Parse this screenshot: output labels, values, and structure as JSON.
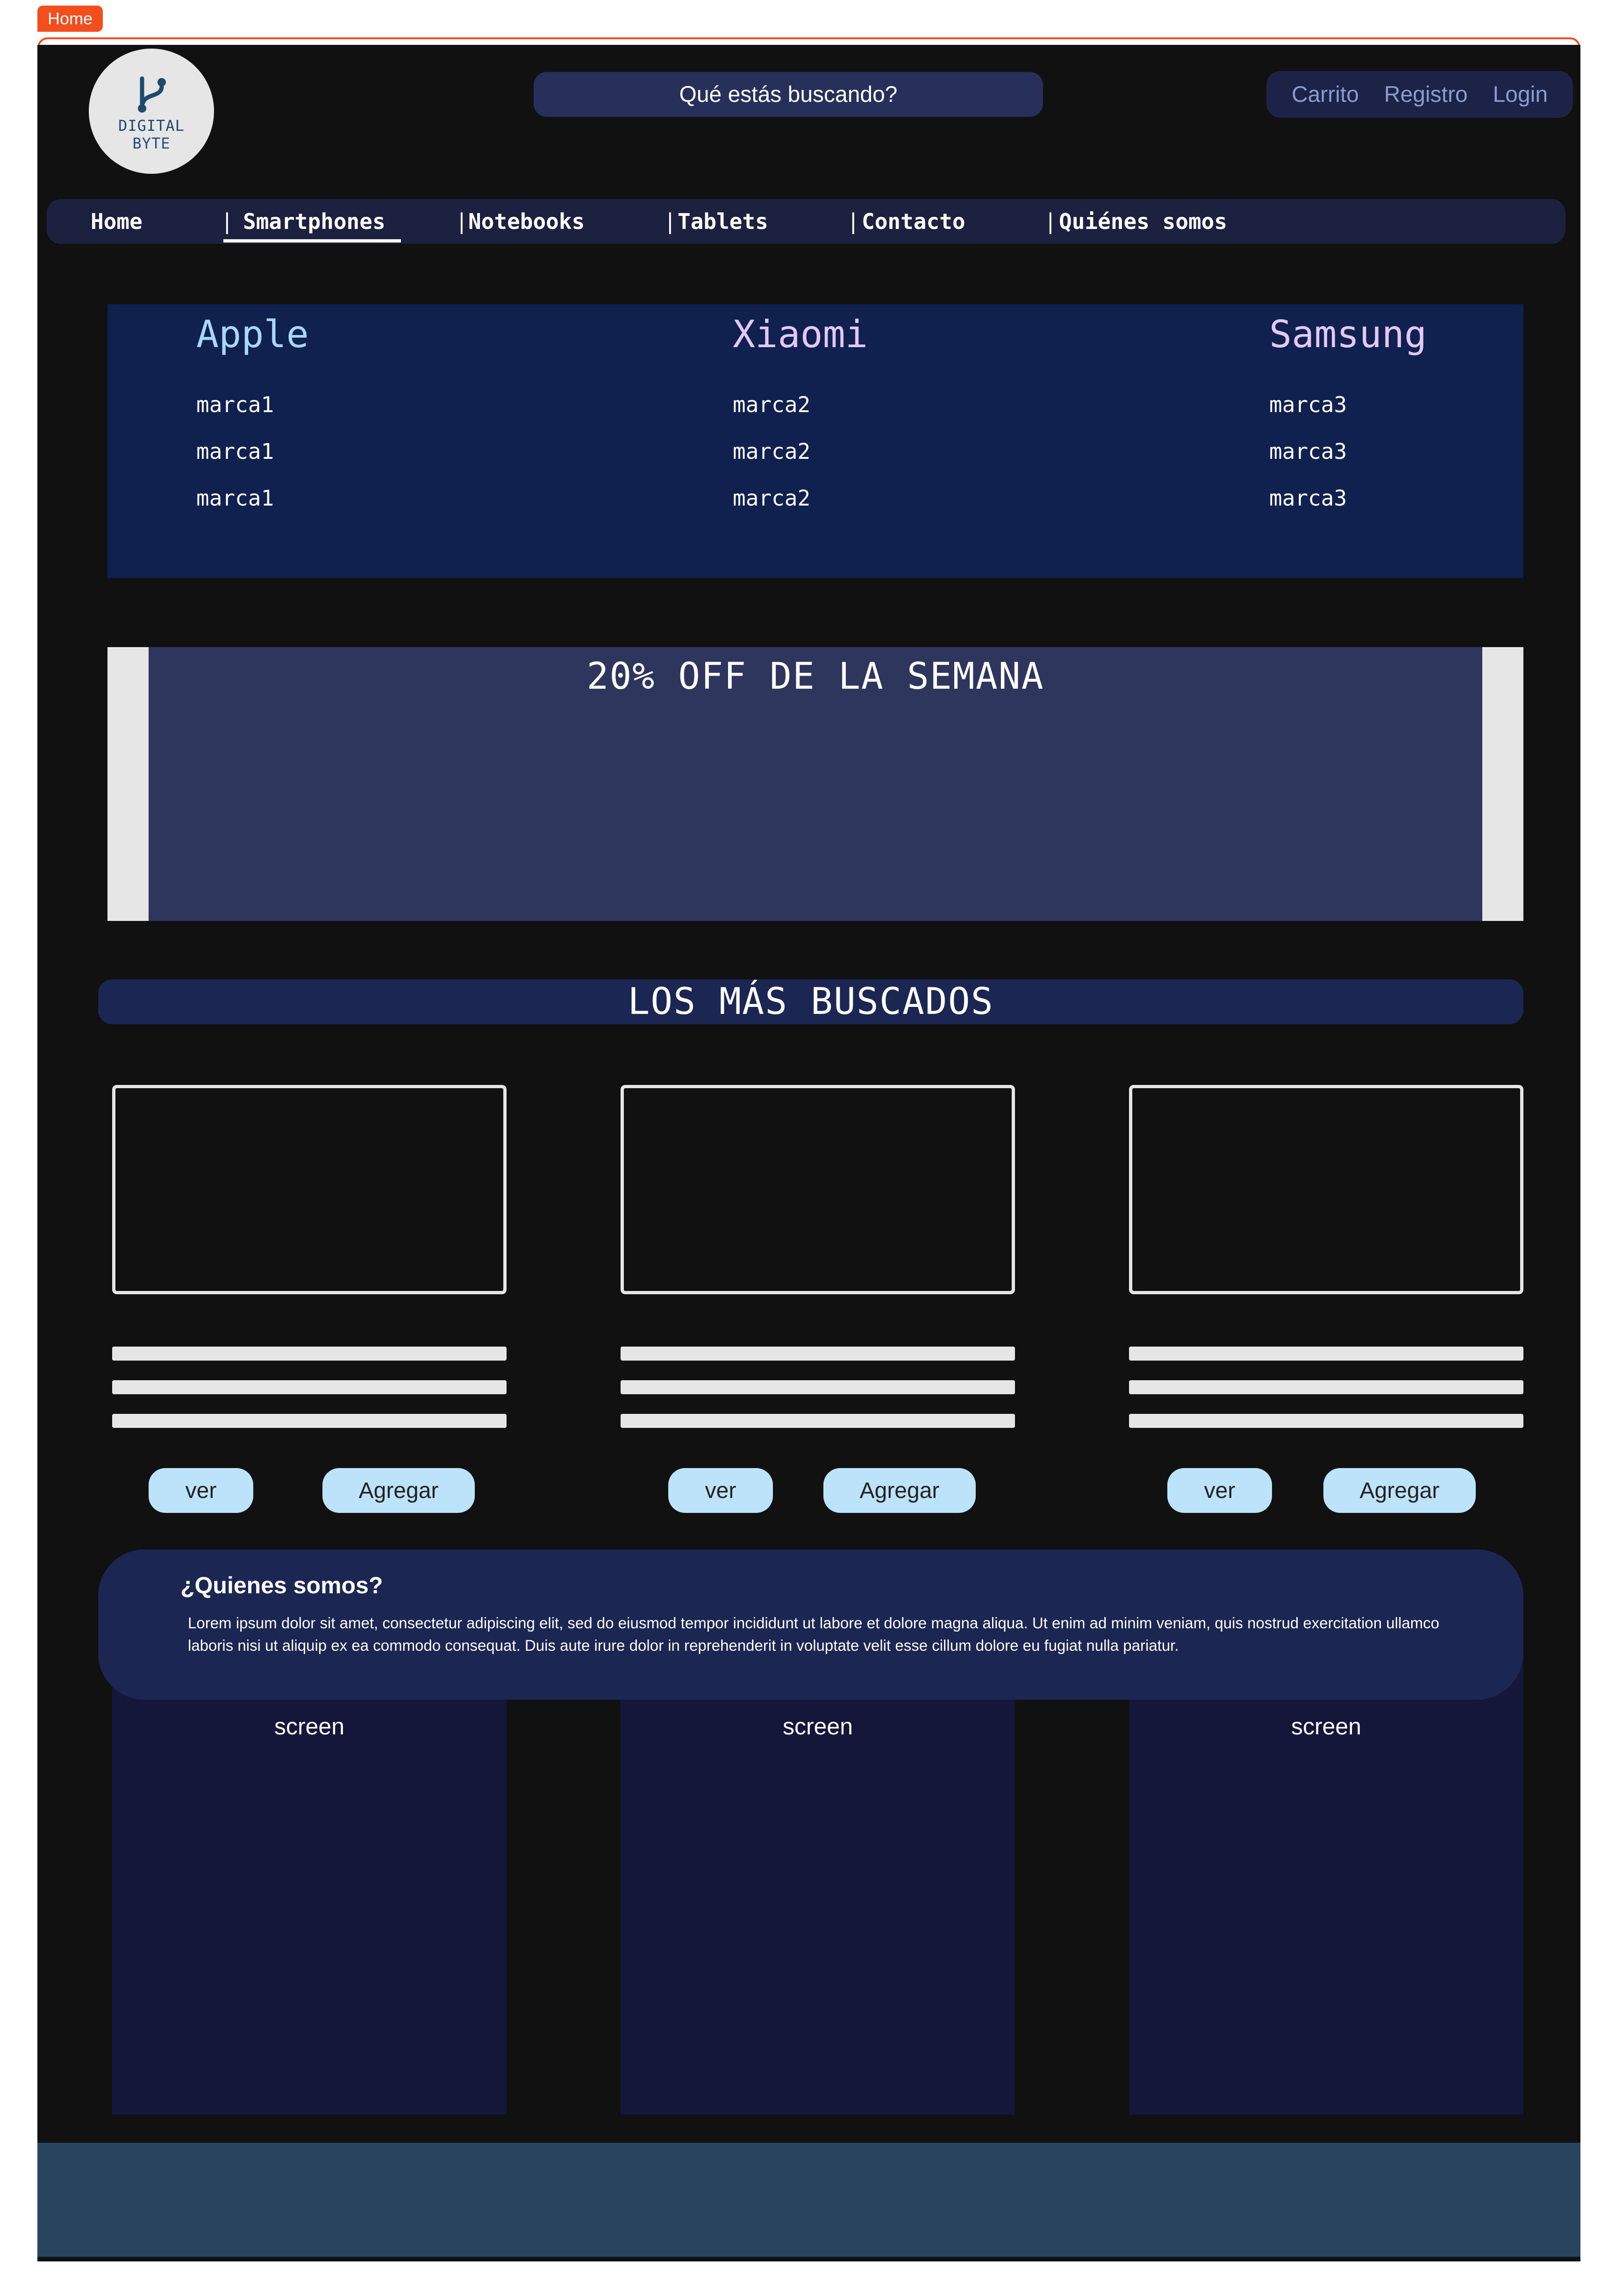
{
  "frame": {
    "label": "Home"
  },
  "logo": {
    "line1": "DIGITAL",
    "line2": "BYTE"
  },
  "search": {
    "placeholder": "Qué estás buscando?"
  },
  "user_nav": {
    "cart": "Carrito",
    "register": "Registro",
    "login": "Login"
  },
  "main_nav": {
    "items": [
      "Home",
      "Smartphones",
      "Notebooks",
      "Tablets",
      "Contacto",
      "Quiénes somos"
    ],
    "separator": "|",
    "active": "Smartphones"
  },
  "brands": [
    {
      "title": "Apple",
      "color": "#a8d8f8",
      "items": [
        "marca1",
        "marca1",
        "marca1"
      ]
    },
    {
      "title": "Xiaomi",
      "color": "#e3c8f5",
      "items": [
        "marca2",
        "marca2",
        "marca2"
      ]
    },
    {
      "title": "Samsung",
      "color": "#e3c8f5",
      "items": [
        "marca3",
        "marca3",
        "marca3"
      ]
    }
  ],
  "promo": {
    "title": "20% OFF DE LA SEMANA"
  },
  "most_searched": {
    "title": "LOS MÁS BUSCADOS",
    "cards": [
      {
        "view": "ver",
        "add": "Agregar"
      },
      {
        "view": "ver",
        "add": "Agregar"
      },
      {
        "view": "ver",
        "add": "Agregar"
      }
    ]
  },
  "about": {
    "title": "¿Quienes somos?",
    "text": "Lorem ipsum dolor sit amet, consectetur adipiscing elit, sed do eiusmod tempor incididunt ut labore et dolore magna aliqua. Ut enim ad minim veniam, quis nostrud exercitation ullamco laboris nisi ut aliquip ex ea commodo consequat. Duis aute irure dolor in reprehenderit in voluptate velit esse cillum dolore eu fugiat nulla pariatur."
  },
  "screens": [
    "screen",
    "screen",
    "screen"
  ],
  "colors": {
    "background": "#111111",
    "frame_accent": "#f24e1e",
    "button": "#bde3fb",
    "footer": "#2a4560"
  }
}
